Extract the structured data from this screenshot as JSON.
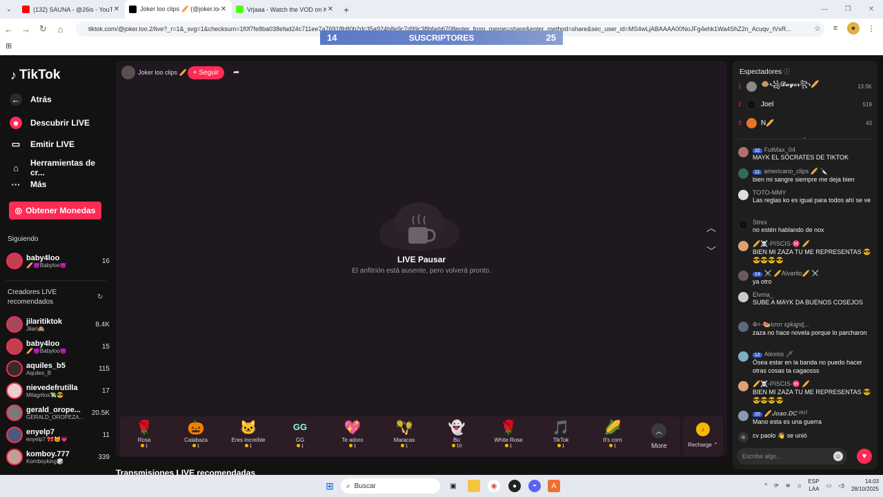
{
  "browser": {
    "tabs": [
      {
        "title": "(132) SAUNA - @26is - YouTube",
        "fav_color": "#ff0000",
        "active": false
      },
      {
        "title": "Joker loo clips 🥖 (@joker.loo.2",
        "fav_color": "#000000",
        "active": true
      },
      {
        "title": "Vrjaaa - Watch the VOD on Kick",
        "fav_color": "#53fc18",
        "active": false
      }
    ],
    "url": "tiktok.com/@joker.loo.2/live?_r=1&_svg=1&checksum=1f0f7fe8ba038efad24c711ee7a76918b80b2dc35a924b8e9c7d99c38b6eb6708enter_from_merge=share&enter_method=share&sec_user_id=MS4wLjABAAAA00NoJFg4ehk1Wa4ShZ2n_Acuqv_tVxR...",
    "overlay": {
      "left": "14",
      "label": "SUSCRIPTORES",
      "right": "25"
    }
  },
  "sidebar": {
    "logo": "TikTok",
    "back": "Atrás",
    "nav": [
      "Descubrir LIVE",
      "Emitir LIVE",
      "Herramientas de cr...",
      "Más"
    ],
    "coins_button": "Obtener Monedas",
    "following_head": "Siguiendo",
    "following": [
      {
        "name": "baby4loo",
        "sub": "🥖😈Babyloo😈",
        "count": "16"
      }
    ],
    "recommended_head": "Creadores LIVE recomendados",
    "recommended": [
      {
        "name": "jilaritiktok",
        "sub": "Jilari🙈",
        "count": "8.4K"
      },
      {
        "name": "baby4loo",
        "sub": "🥖😈Babyloo😈",
        "count": "15"
      },
      {
        "name": "aquiles_b5",
        "sub": "Aquiles_B",
        "count": "115"
      },
      {
        "name": "nievedefrutilla",
        "sub": "Milagritos💸😎",
        "count": "17"
      },
      {
        "name": "gerald_orope...",
        "sub": "GERALD_OROPEZA...",
        "count": "20.5K"
      },
      {
        "name": "enyelp7",
        "sub": "enyelp7 🎀😺💗",
        "count": "11"
      },
      {
        "name": "komboy.777",
        "sub": "Komboyking🎲",
        "count": "339"
      }
    ]
  },
  "player": {
    "host_name": "Joker loo clips 🥖",
    "follow": "+ Seguir",
    "pause_title": "LIVE Pausar",
    "pause_sub": "El anfitrión está ausente, pero volverá pronto.",
    "gifts": [
      {
        "icon": "🌹",
        "name": "Rosa",
        "price": "1"
      },
      {
        "icon": "🎃",
        "name": "Calabaza",
        "price": "1"
      },
      {
        "icon": "🐱",
        "name": "Eres increíble",
        "price": "1"
      },
      {
        "icon": "GG",
        "name": "GG",
        "price": "1"
      },
      {
        "icon": "💖",
        "name": "Te adoro",
        "price": "1"
      },
      {
        "icon": "🪇",
        "name": "Maracas",
        "price": "1"
      },
      {
        "icon": "👻",
        "name": "Bu",
        "price": "10"
      },
      {
        "icon": "🌹",
        "name": "White Rose",
        "price": "1"
      },
      {
        "icon": "🎵",
        "name": "TikTok",
        "price": "1"
      },
      {
        "icon": "🌽",
        "name": "It's corn",
        "price": "1"
      }
    ],
    "more": "More",
    "recharge": "Recharge",
    "recommended_title": "Transmisiones LIVE recomendadas"
  },
  "chat": {
    "viewers_head": "Espectadores",
    "viewers": [
      {
        "rank": "1",
        "name": "🐵꧁𝓓𝓪𝔂𝓮𝓻꧂🥖",
        "count": "13.5K",
        "color": "#8a8a8a"
      },
      {
        "rank": "2",
        "name": "Joel",
        "count": "519",
        "color": "#111111"
      },
      {
        "rank": "3",
        "name": "N🥖",
        "count": "43",
        "color": "#e8742a"
      }
    ],
    "messages": [
      {
        "user": "FutMax_04",
        "level": "32",
        "text": "MAYK EL SÓCRATES DE TIKTOK",
        "color": "#b07070"
      },
      {
        "user": "americano_clips 🥖 🔪",
        "level": "11",
        "text": "bien mi sangre siempre me deja bien",
        "color": "#2f6d5a"
      },
      {
        "user": "TOTO-MMY",
        "level": "",
        "text": "Las reglas ko es igual para todos ahí se ve",
        "color": "#dddddd"
      },
      {
        "user": "Strex",
        "level": "",
        "text": "no estén hablando de nox",
        "color": "#111111"
      },
      {
        "user": "🥖☠️-PISCIS-♓ 🥖",
        "level": "",
        "text": "BIEN MI ZAZA TU ME REPRESENTAS 😎😎😎😎😎",
        "color": "#e0a070"
      },
      {
        "user": "⚔️ 🥖Alvarito🥖 ⚔️",
        "level": "14",
        "text": "ya otro",
        "color": "#6a5a5a"
      },
      {
        "user": "Elvma_",
        "level": "",
        "text": "SUBE A MAYK DA BUENOS COSEJOS",
        "color": "#cccccc"
      },
      {
        "user": "Φ+-🍉Ɩơơɾ ɛʂƙąɲɖ...",
        "level": "",
        "text": "zaza no hace novela porque lo parcharon",
        "color": "#5a6a7a"
      },
      {
        "user": "Alexiss 🗡",
        "level": "12",
        "text": "Ósea estar en la banda no puedo hacer otras cosas ta cagaosss",
        "color": "#7ab0c0"
      },
      {
        "user": "🥖☠️-PISCIS-♓ 🥖",
        "level": "",
        "text": "BIEN MI ZAZA TU ME REPRESENTAS 😎😎😎😎😎",
        "color": "#e0a070"
      },
      {
        "user": "🥖𝑱𝒐𝒂𝒐.𝑫𝑪 ᴾᴱᴵᵀ",
        "level": "20",
        "text": "Mano esta es una guerra",
        "color": "#8a9ab0"
      }
    ],
    "join_text": "cv paolo 👋 se unió",
    "comment_placeholder": "Escribe algo..."
  },
  "taskbar": {
    "search": "Buscar",
    "lang": "ESP",
    "lang2": "LAA",
    "time": "14:03",
    "date": "28/10/2025"
  }
}
